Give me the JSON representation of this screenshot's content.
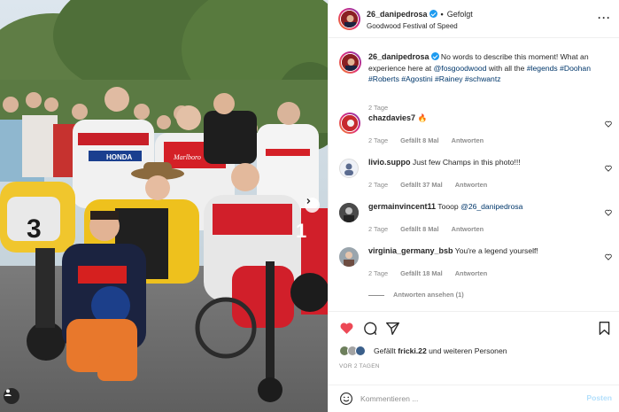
{
  "photo": {
    "alt_subject": "group-photo",
    "tag_icon": "user-tag-icon",
    "next_icon": "chevron-right-icon",
    "bike_number_left": "3",
    "bike_number_right": "1",
    "logo_honda": "HONDA",
    "logo_marlboro": "Marlboro"
  },
  "header": {
    "username": "26_danipedrosa",
    "separator": "•",
    "follow_label": "Gefolgt",
    "location": "Goodwood Festival of Speed",
    "more_icon": "more-dots-icon"
  },
  "caption": {
    "username": "26_danipedrosa",
    "text_1": "No words to describe this moment! What an experience here at ",
    "mention": "@fosgoodwood",
    "text_2": " with all the ",
    "hashtags_1": "#legends",
    "hashtags_2": "#Doohan #Roberts #Agostini #Rainey #schwantz",
    "time": "2 Tage"
  },
  "comments": [
    {
      "username": "chazdavies7",
      "text": "🔥",
      "time": "2 Tage",
      "likes": "Gefällt 8 Mal",
      "reply": "Antworten"
    },
    {
      "username": "livio.suppo",
      "text": "Just few Champs in this photo!!!",
      "time": "2 Tage",
      "likes": "Gefällt 37 Mal",
      "reply": "Antworten"
    },
    {
      "username": "germainvincent11",
      "text": "Tooop ",
      "mention": "@26_danipedrosa",
      "time": "2 Tage",
      "likes": "Gefällt 8 Mal",
      "reply": "Antworten"
    },
    {
      "username": "virginia_germany_bsb",
      "text": "You're a legend yourself!",
      "time": "2 Tage",
      "likes": "Gefällt 18 Mal",
      "reply": "Antworten",
      "view_replies": "Antworten ansehen (1)"
    }
  ],
  "actions": {
    "like_icon": "heart-filled-icon",
    "comment_icon": "comment-icon",
    "share_icon": "send-icon",
    "save_icon": "bookmark-icon",
    "liked_prefix": "Gefällt ",
    "liked_user": "fricki.22",
    "liked_suffix": " und weiteren Personen",
    "timestamp": "VOR 2 TAGEN",
    "like_color": "#ed4956"
  },
  "composer": {
    "emoji_icon": "emoji-icon",
    "placeholder": "Kommentieren ...",
    "post_label": "Posten"
  }
}
